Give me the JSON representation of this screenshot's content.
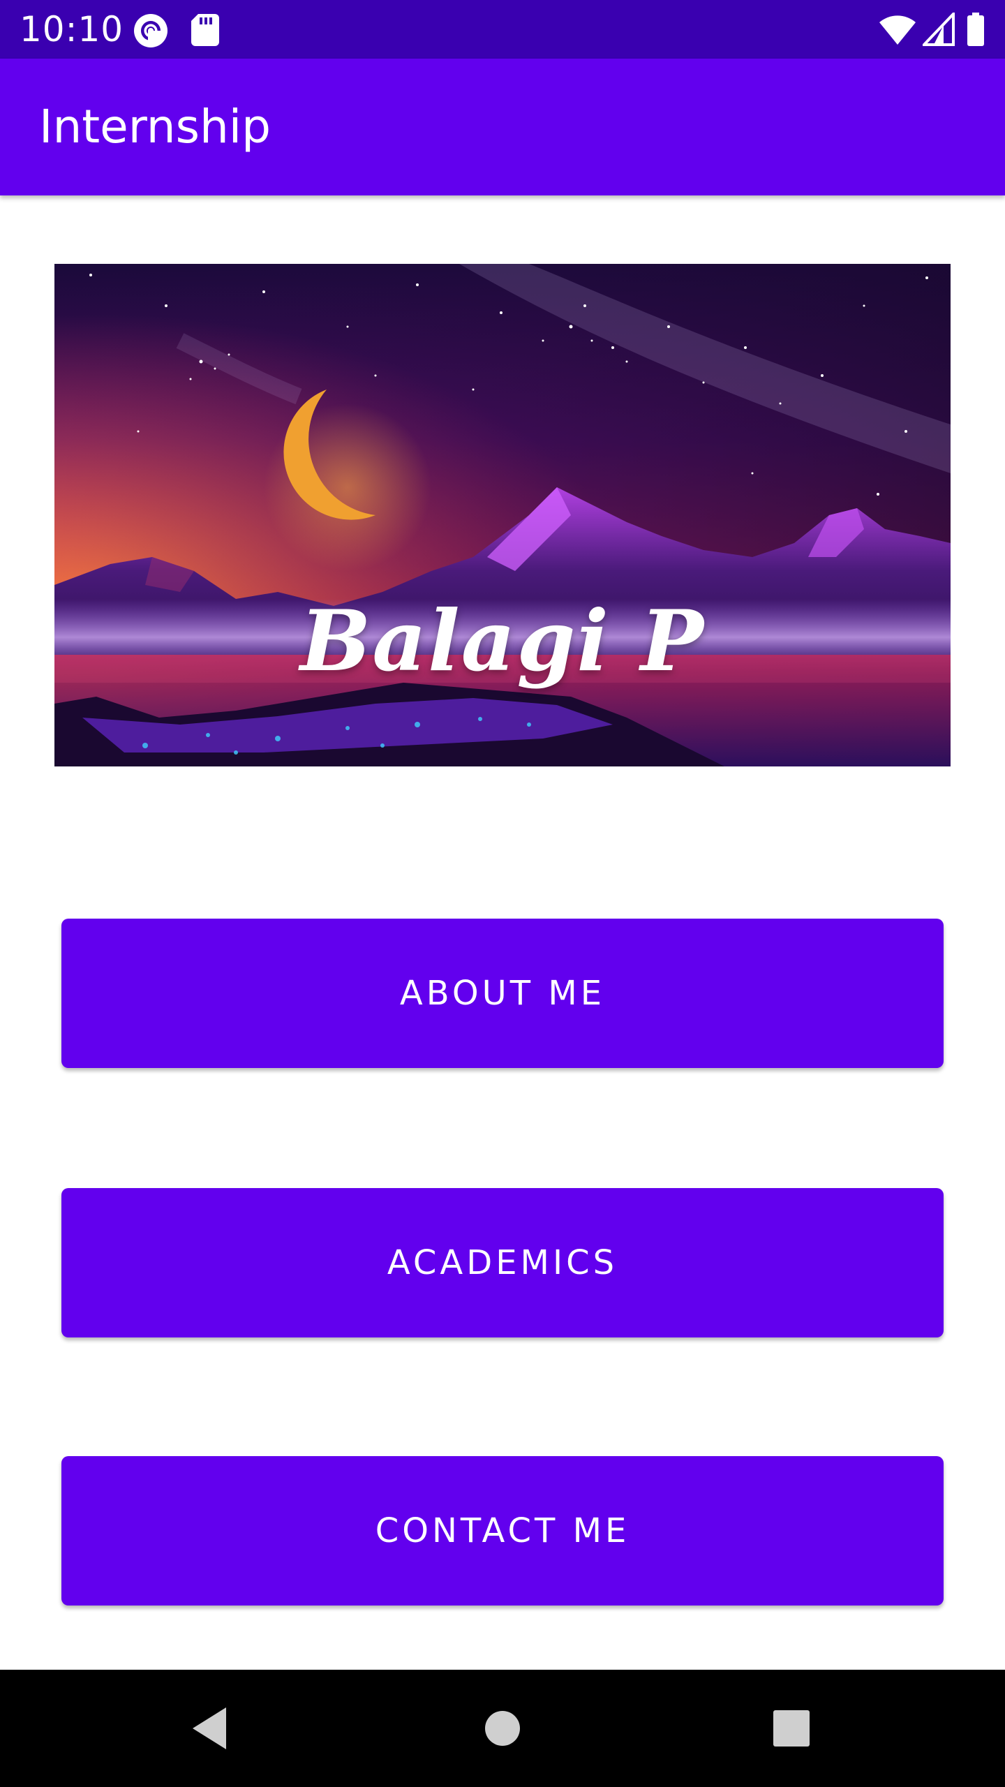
{
  "status_bar": {
    "time": "10:10",
    "left_icons": [
      "pocket-casts-icon",
      "sd-card-icon"
    ],
    "right_icons": [
      "wifi-icon",
      "signal-icon",
      "battery-icon"
    ]
  },
  "app_bar": {
    "title": "Internship"
  },
  "banner": {
    "name_text": "Balagi P"
  },
  "buttons": [
    {
      "label": "ABOUT ME"
    },
    {
      "label": "ACADEMICS"
    },
    {
      "label": "CONTACT ME"
    }
  ],
  "nav_bar": {
    "icons": [
      "back-icon",
      "home-icon",
      "recents-icon"
    ]
  },
  "colors": {
    "primary": "#6200ee",
    "primary_dark": "#3a00b0",
    "on_primary": "#ffffff"
  }
}
